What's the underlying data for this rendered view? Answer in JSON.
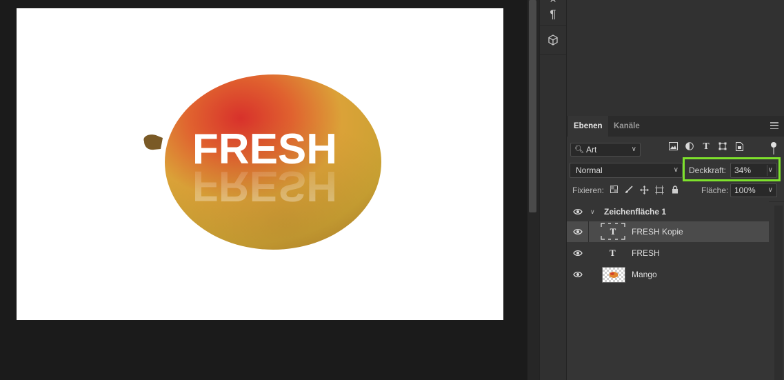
{
  "canvas": {
    "headline": "FRESH",
    "reflection": "FRESH"
  },
  "layers_panel": {
    "tabs": [
      {
        "label": "Ebenen",
        "active": true
      },
      {
        "label": "Kanäle",
        "active": false
      }
    ],
    "filter": {
      "label": "Art",
      "icons": [
        "image-filter-icon",
        "adjustment-filter-icon",
        "type-filter-icon",
        "shape-filter-icon",
        "smart-object-filter-icon"
      ]
    },
    "blend_mode": "Normal",
    "opacity": {
      "label": "Deckkraft:",
      "value": "34%"
    },
    "lock": {
      "label": "Fixieren:",
      "icons": [
        "lock-transparency-icon",
        "lock-image-icon",
        "lock-position-icon",
        "lock-artboard-icon",
        "lock-all-icon"
      ]
    },
    "fill": {
      "label": "Fläche:",
      "value": "100%"
    },
    "layers": [
      {
        "name": "Zeichenfläche 1",
        "kind": "artboard",
        "expanded": true,
        "visible": true
      },
      {
        "name": "FRESH Kopie",
        "kind": "text",
        "selected": true,
        "visible": true
      },
      {
        "name": "FRESH",
        "kind": "text",
        "visible": true
      },
      {
        "name": "Mango",
        "kind": "image",
        "visible": true
      }
    ]
  },
  "colors": {
    "highlight": "#7ee22c",
    "panel_bg": "#353535",
    "selected_row": "#4b4b4b"
  }
}
